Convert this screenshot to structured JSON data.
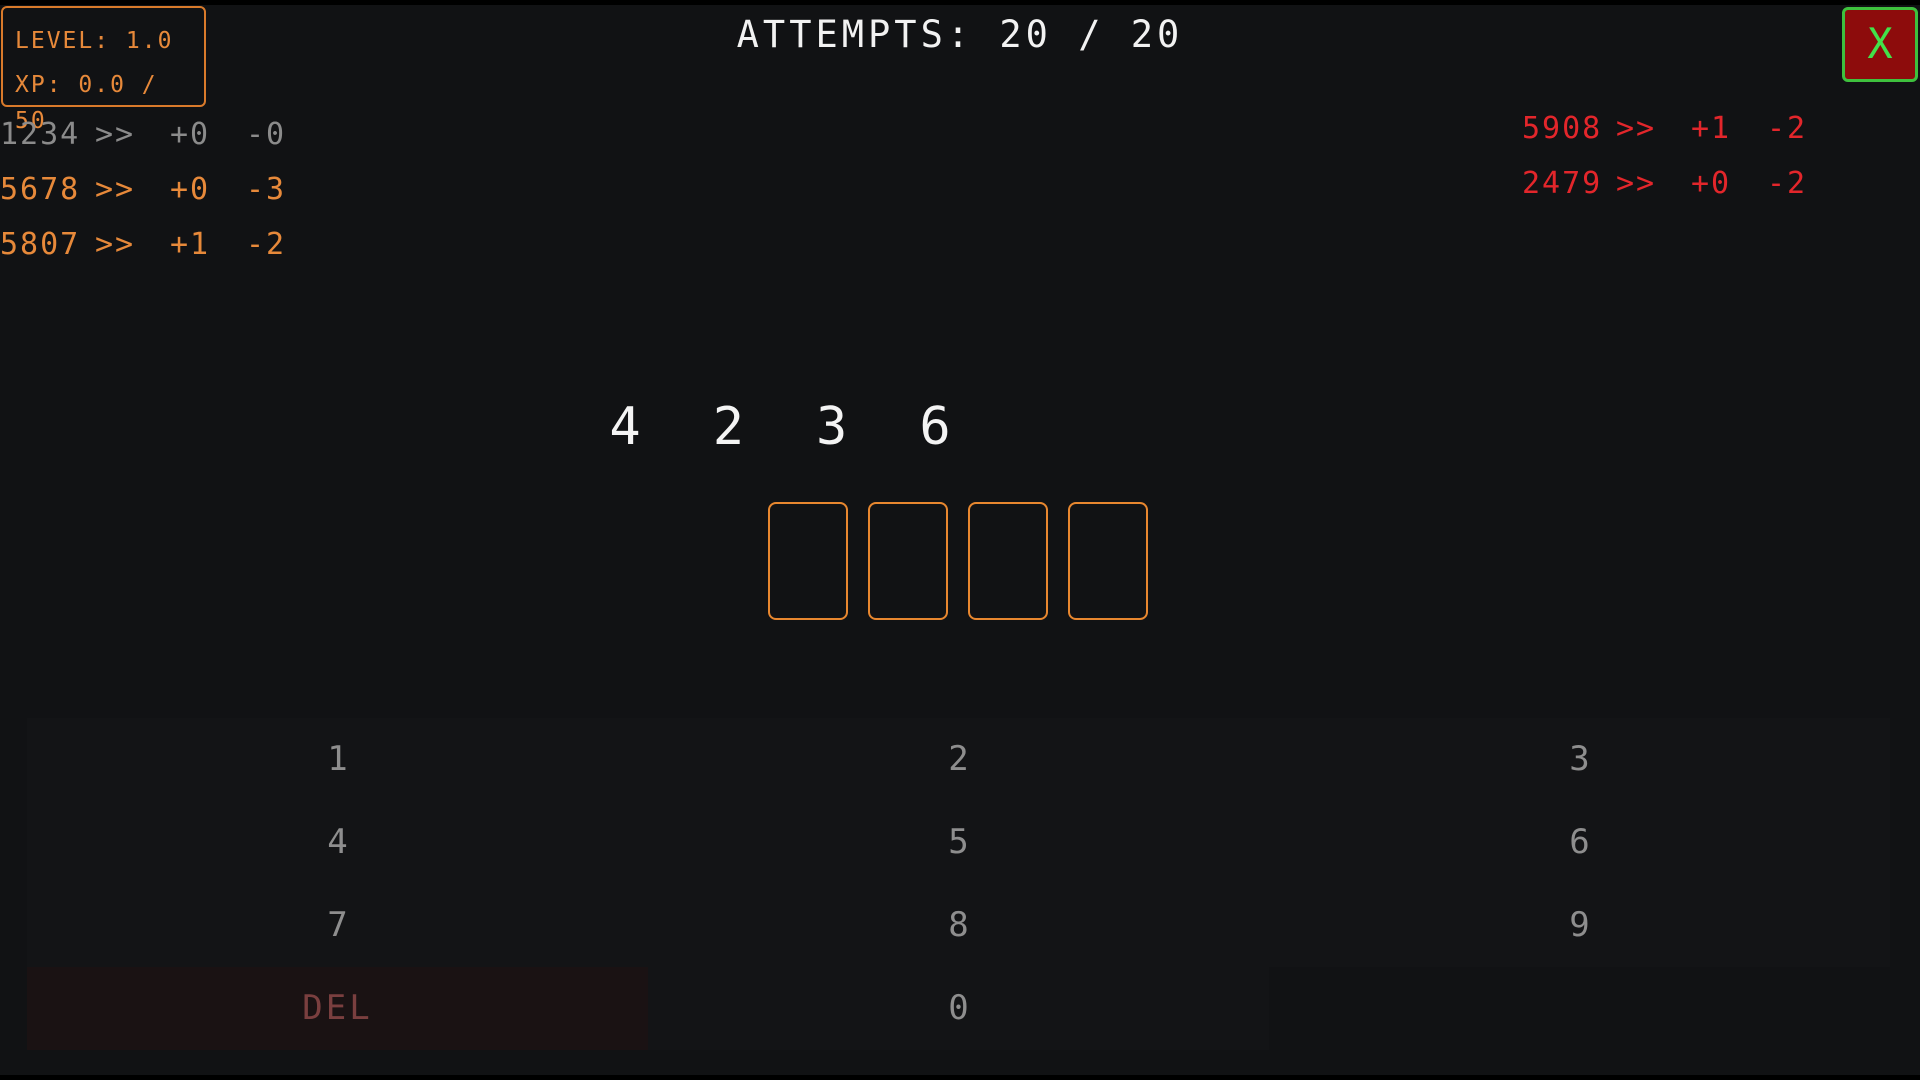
{
  "stats": {
    "level_text": "LEVEL: 1.0",
    "xp_text": "XP: 0.0 / 50"
  },
  "attempts_text": "ATTEMPTS: 20 / 20",
  "close_label": "X",
  "history_left": [
    {
      "code": "1234",
      "arrow": ">>",
      "plus": "+0",
      "minus": "-0",
      "color": "#8b8b8b"
    },
    {
      "code": "5678",
      "arrow": ">>",
      "plus": "+0",
      "minus": "-3",
      "color": "#e7893a"
    },
    {
      "code": "5807",
      "arrow": ">>",
      "plus": "+1",
      "minus": "-2",
      "color": "#e7893a"
    }
  ],
  "history_right": [
    {
      "code": "5908",
      "arrow": ">>",
      "plus": "+1",
      "minus": "-2",
      "color": "#e3262b"
    },
    {
      "code": "2479",
      "arrow": ">>",
      "plus": "+0",
      "minus": "-2",
      "color": "#e3262b"
    }
  ],
  "secret_digits": [
    "4",
    "2",
    "3",
    "6"
  ],
  "input_slots": [
    "",
    "",
    "",
    ""
  ],
  "keypad": {
    "k1": "1",
    "k2": "2",
    "k3": "3",
    "k4": "4",
    "k5": "5",
    "k6": "6",
    "k7": "7",
    "k8": "8",
    "k9": "9",
    "del": "DEL",
    "k0": "0"
  },
  "colors": {
    "accent_orange": "#e8872f",
    "danger_red": "#e3262b",
    "close_bg": "#8d0c0c",
    "close_border": "#3ec13e",
    "background": "#111214"
  }
}
